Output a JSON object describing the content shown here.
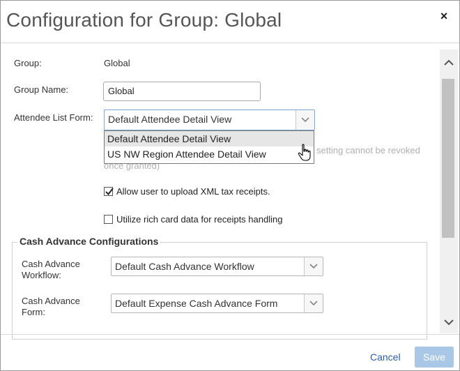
{
  "dialog": {
    "title": "Configuration for Group: Global",
    "close_glyph": "×"
  },
  "form": {
    "group_label": "Group:",
    "group_value": "Global",
    "group_name_label": "Group Name:",
    "group_name_value": "Global",
    "attendee_list_form_label": "Attendee List Form:",
    "attendee_list_form_selected": "Default Attendee Detail View",
    "attendee_list_form_options": [
      "Default Attendee Detail View",
      "US NW Region Attendee Detail View"
    ],
    "hidden_text_1": "setting cannot be revoked",
    "hidden_text_2": "once granted)",
    "allow_xml_label": "Allow user to upload XML tax receipts.",
    "allow_xml_checked": true,
    "rich_card_label": "Utilize rich card data for receipts handling",
    "rich_card_checked": false
  },
  "cash_advance": {
    "legend": "Cash Advance Configurations",
    "workflow_label_1": "Cash Advance",
    "workflow_label_2": "Workflow:",
    "workflow_selected": "Default Cash Advance Workflow",
    "form_label_1": "Cash Advance",
    "form_label_2": "Form:",
    "form_selected": "Default Expense Cash Advance Form"
  },
  "footer": {
    "cancel_label": "Cancel",
    "save_label": "Save"
  },
  "colors": {
    "link": "#2a5ea8",
    "save_disabled": "#a9c8e8"
  },
  "icons": {
    "close": "close-icon",
    "dropdown": "chevron-down-icon",
    "scroll_up": "chevron-up-icon",
    "scroll_down": "chevron-down-icon",
    "cursor": "hand-pointer-icon",
    "check": "check-icon"
  }
}
